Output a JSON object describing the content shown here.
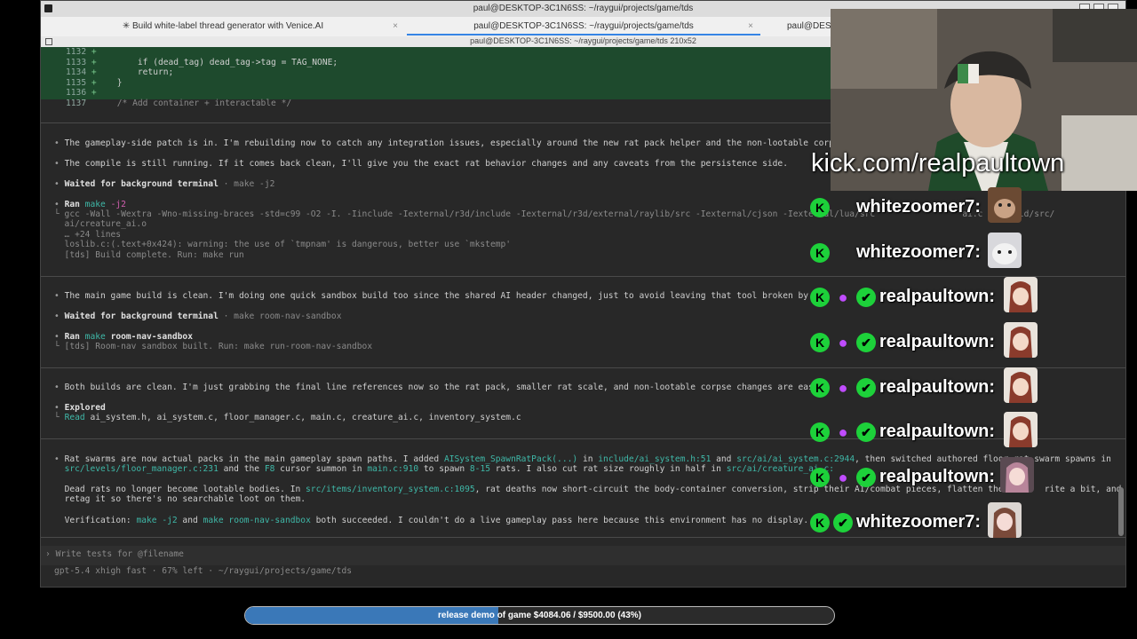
{
  "window": {
    "title": "paul@DESKTOP-3C1N6SS: ~/raygui/projects/game/tds",
    "tabs": [
      {
        "label": "✳ Build white-label thread generator with Venice.AI"
      },
      {
        "label": "paul@DESKTOP-3C1N6SS: ~/raygui/projects/game/tds"
      },
      {
        "label": "paul@DESK"
      }
    ],
    "path_title": "paul@DESKTOP-3C1N6SS: ~/raygui/projects/game/tds 210x52"
  },
  "terminal": {
    "diff": [
      {
        "num": "1132",
        "mark": "+",
        "code": ""
      },
      {
        "num": "1133",
        "mark": "+",
        "code": "        if (dead_tag) dead_tag->tag = TAG_NONE;"
      },
      {
        "num": "1134",
        "mark": "+",
        "code": "        return;"
      },
      {
        "num": "1135",
        "mark": "+",
        "code": "    }"
      },
      {
        "num": "1136",
        "mark": "+",
        "code": ""
      },
      {
        "num": "1137",
        "mark": "",
        "code": "    /* Add container + interactable */"
      }
    ],
    "msg1": "The gameplay-side patch is in. I'm rebuilding now to catch any integration issues, especially around the new rat pack helper and the non-lootable corpse",
    "msg2": "The compile is still running. If it comes back clean, I'll give you the exact rat behavior changes and any caveats from the persistence side.",
    "wait1_label": "Waited for background terminal",
    "wait1_cmd": "· make -j2",
    "ran1_label": "Ran",
    "ran1_cmd": "make",
    "ran1_arg": "-j2",
    "ran1_out1": "└ gcc -Wall -Wextra -Wno-missing-braces -std=c99 -O2 -I. -Iinclude -Iexternal/r3d/include -Iexternal/r3d/external/raylib/src -Iexternal/cjson -Iexternal/lua/src                 ai.c -o build/src/",
    "ran1_out2": "  ai/creature_ai.o",
    "ran1_out3": "  … +24 lines",
    "ran1_out4": "  loslib.c:(.text+0x424): warning: the use of `tmpnam' is dangerous, better use `mkstemp'",
    "ran1_out5": "  [tds] Build complete. Run: make run",
    "msg3": "The main game build is clean. I'm doing one quick sandbox build too since the shared AI header changed, just to avoid leaving that tool broken by the",
    "wait2_label": "Waited for background terminal",
    "wait2_cmd": "· make room-nav-sandbox",
    "ran2_label": "Ran",
    "ran2_cmd": "make",
    "ran2_arg": "room-nav-sandbox",
    "ran2_out": "└ [tds] Room-nav sandbox built. Run: make run-room-nav-sandbox",
    "msg4": "Both builds are clean. I'm just grabbing the final line references now so the rat pack, smaller rat scale, and non-lootable corpse changes are easy",
    "explored_label": "Explored",
    "read_label": "Read",
    "read_files": "ai_system.h, ai_system.c, floor_manager.c, main.c, creature_ai.c, inventory_system.c",
    "sum1_a": "Rat swarms are now actual packs in the main gameplay spawn paths. I added ",
    "sum1_b": "AISystem_SpawnRatPack(...)",
    "sum1_c": " in ",
    "sum1_d": "include/ai_system.h:51",
    "sum1_e": " and ",
    "sum1_f": "src/ai/ai_system.c:2944",
    "sum1_g": ", then switched authored floor rat swarm spawns in",
    "sum2_a": "src/levels/floor_manager.c:231",
    "sum2_b": " and the ",
    "sum2_c": "F8",
    "sum2_d": " cursor summon in ",
    "sum2_e": "main.c:910",
    "sum2_f": " to spawn ",
    "sum2_g": "8-15",
    "sum2_h": " rats. I also cut rat size roughly in half in ",
    "sum2_i": "src/ai/creature_ai.c:",
    "dead1_a": "Dead rats no longer become lootable bodies. In ",
    "dead1_b": "src/items/inventory_system.c:1095",
    "dead1_c": ", rat deaths now short-circuit the body-container conversion, strip their AI/combat pieces, flatten the co     rite a bit, and",
    "dead2": "retag it so there's no searchable loot on them.",
    "ver_a": "Verification: ",
    "ver_b": "make -j2",
    "ver_c": " and ",
    "ver_d": "make room-nav-sandbox",
    "ver_e": " both succeeded. I couldn't do a live gameplay pass here because this environment has no display.",
    "prompt_placeholder": "Write tests for @filename",
    "status": "gpt-5.4 xhigh fast · 67% left · ~/raygui/projects/game/tds"
  },
  "overlay": {
    "kick_url": "kick.com/realpaultown",
    "chat": [
      {
        "name": "whitezoomer7:",
        "badges": [
          "kick-badge"
        ]
      },
      {
        "name": "whitezoomer7:",
        "badges": [
          "kick-badge"
        ]
      },
      {
        "name": "realpaultown:",
        "badges": [
          "kick-badge",
          "mic-badge",
          "verified-badge"
        ]
      },
      {
        "name": "realpaultown:",
        "badges": [
          "kick-badge",
          "mic-badge",
          "verified-badge"
        ]
      },
      {
        "name": "realpaultown:",
        "badges": [
          "kick-badge",
          "mic-badge",
          "verified-badge"
        ]
      },
      {
        "name": "realpaultown:",
        "badges": [
          "kick-badge",
          "mic-badge",
          "verified-badge"
        ]
      },
      {
        "name": "realpaultown:",
        "badges": [
          "kick-badge",
          "mic-badge",
          "verified-badge"
        ]
      },
      {
        "name": "whitezoomer7:",
        "badges": [
          "kick-badge",
          "verified-badge"
        ]
      }
    ],
    "goal": {
      "label": "release demo of game $4084.06 / $9500.00 (43%)",
      "fraction": 0.43
    }
  },
  "colors": {
    "accent": "#3584e4",
    "diff_bg": "#1e4a2d",
    "kick_green": "#1dd13a",
    "link": "#3fb8a8"
  }
}
